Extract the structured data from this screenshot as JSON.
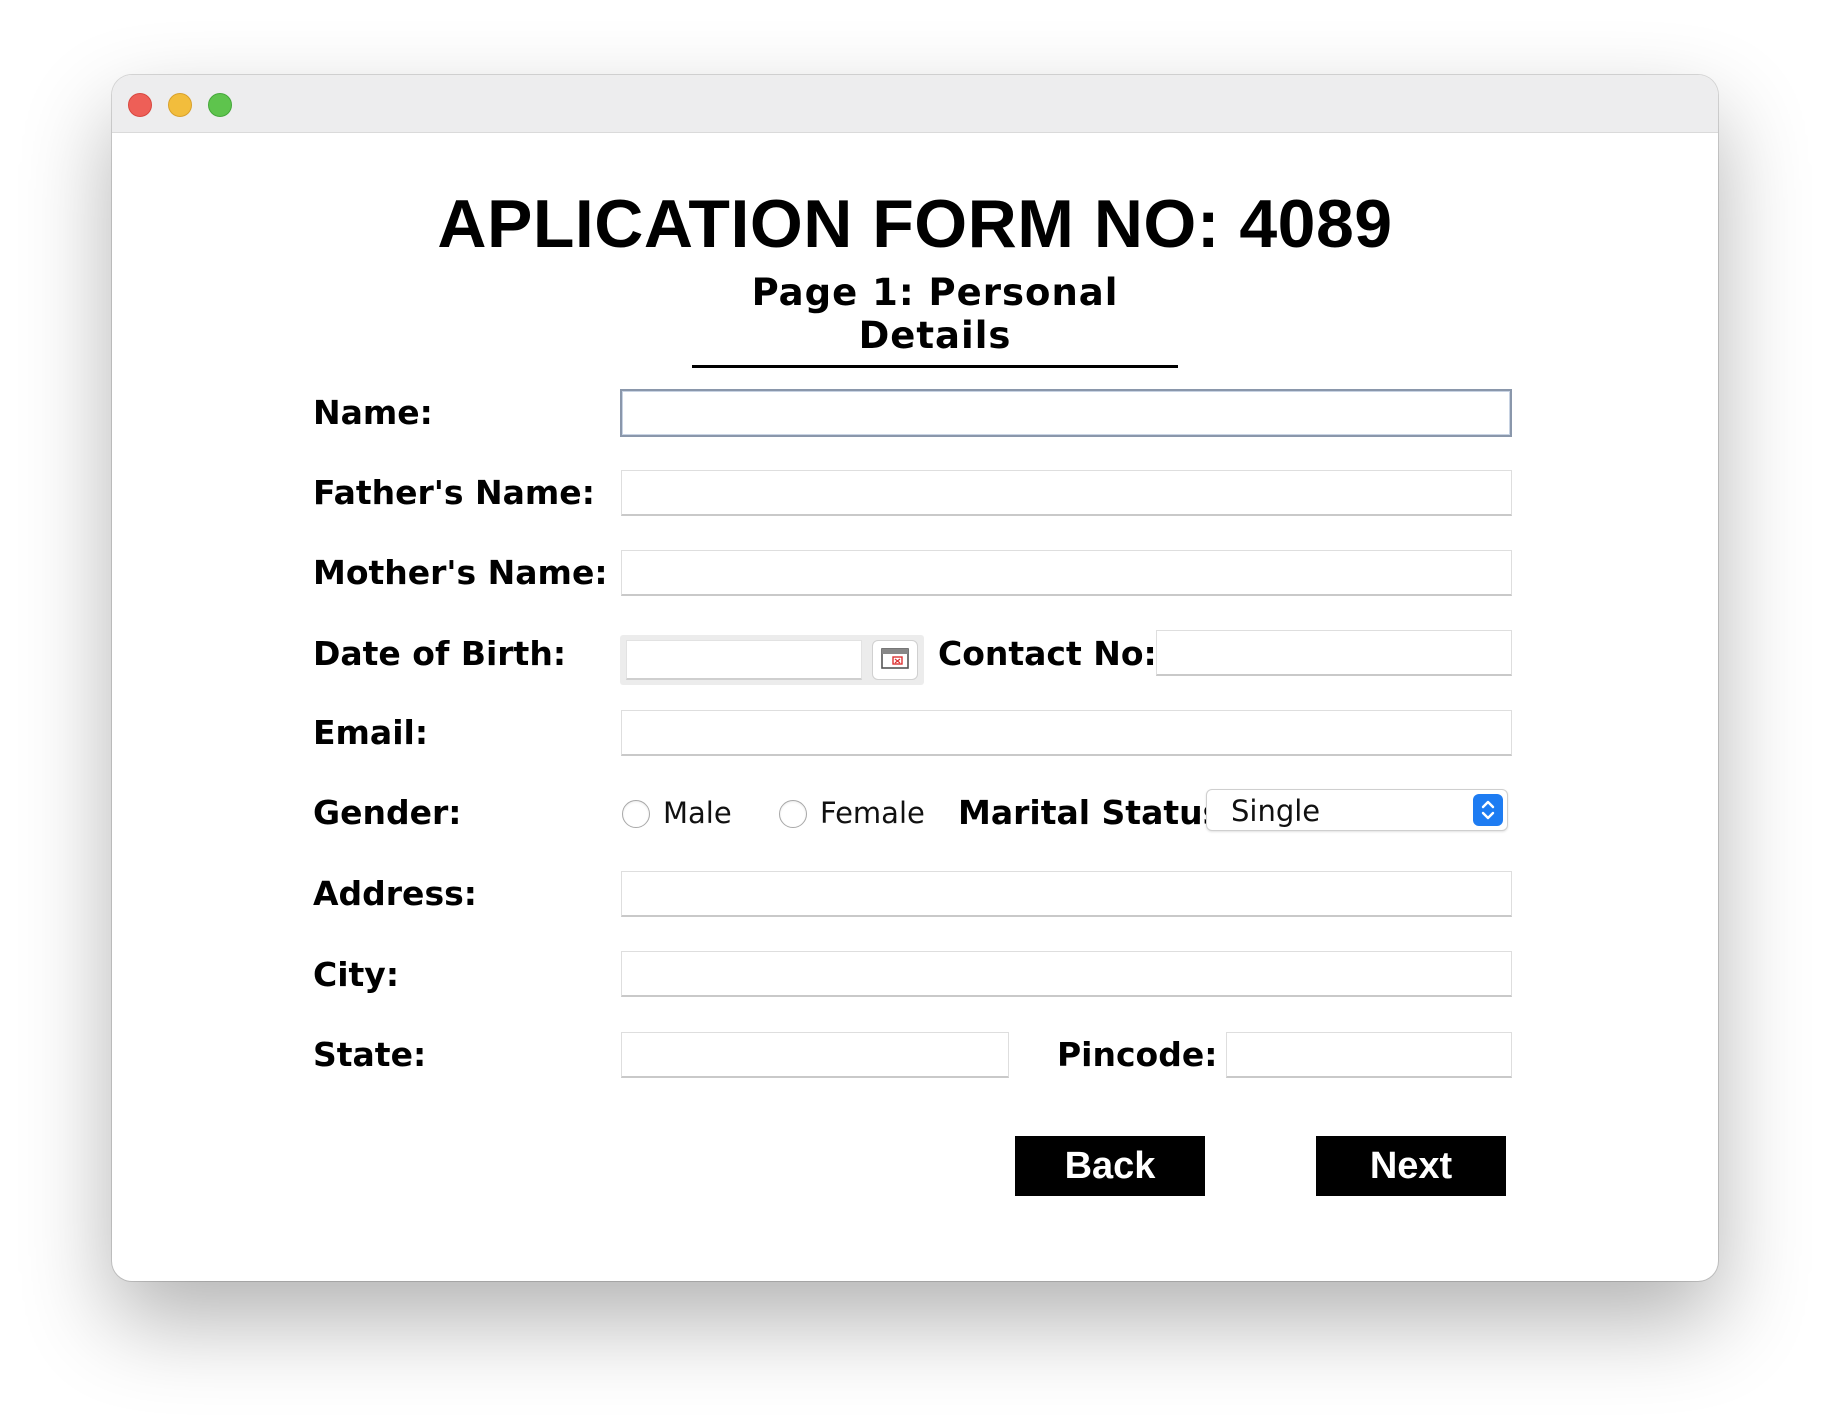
{
  "form": {
    "title": "APLICATION FORM NO: 4089",
    "subtitle": "Page 1: Personal Details"
  },
  "labels": {
    "name": "Name:",
    "father_name": "Father's Name:",
    "mother_name": "Mother's Name:",
    "dob": "Date of Birth:",
    "contact": "Contact No:",
    "email": "Email:",
    "gender": "Gender:",
    "marital_status": "Marital Status:",
    "address": "Address:",
    "city": "City:",
    "state": "State:",
    "pincode": "Pincode:"
  },
  "fields": {
    "name": "",
    "father_name": "",
    "mother_name": "",
    "dob": "",
    "contact": "",
    "email": "",
    "address": "",
    "city": "",
    "state": "",
    "pincode": ""
  },
  "gender": {
    "options": [
      "Male",
      "Female"
    ],
    "selected": null
  },
  "marital_status": {
    "selected": "Single"
  },
  "buttons": {
    "back": "Back",
    "next": "Next"
  },
  "icons": {
    "date_picker": "calendar-icon",
    "select_stepper": "up-down-chevron-icon"
  },
  "colors": {
    "button_bg": "#000000",
    "button_text": "#ffffff",
    "accent": "#1e7cf2"
  }
}
